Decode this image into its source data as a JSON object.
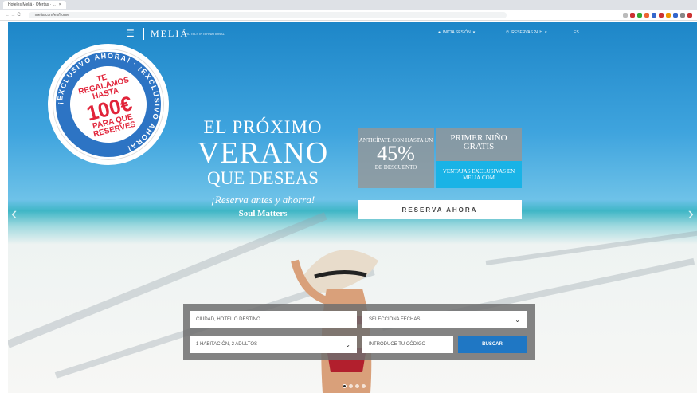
{
  "browser": {
    "tab_title": "Hoteles Meliá · Ofertas · ...",
    "url": "melia.com/es/home",
    "nav_glyphs": "← → C"
  },
  "header": {
    "logo": "MELIÃ",
    "logo_sub": "HOTELS INTERNATIONAL",
    "login": "INICIA SESIÓN",
    "phone": "RESERVAS 24 H",
    "lang": "ES"
  },
  "badge": {
    "ring_text": "¡EXCLUSIVO AHORA! · ¡EXCLUSIVO AHORA!",
    "line1": "TE",
    "line2": "REGALAMOS",
    "line3": "HASTA",
    "amount": "100€",
    "line4": "PARA QUE",
    "line5": "RESERVES"
  },
  "hero": {
    "line1": "EL PRÓXIMO",
    "line2": "VERANO",
    "line3": "QUE DESEAS",
    "tagline": "¡Reserva antes y ahorra!",
    "brand": "Soul Matters"
  },
  "promo": {
    "left_top": "ANTICÍPATE CON HASTA UN",
    "percent": "45%",
    "left_bottom": "DE DESCUENTO",
    "right_top": "PRIMER NIÑO GRATIS",
    "right_bottom": "VENTAJAS EXCLUSIVAS EN MELIA.COM",
    "cta": "RESERVA AHORA"
  },
  "search": {
    "destination_placeholder": "CIUDAD, HOTEL O DESTINO",
    "dates_placeholder": "SELECCIONA FECHAS",
    "rooms_value": "1 HABITACIÓN, 2 ADULTOS",
    "code_placeholder": "INTRODUCE TU CÓDIGO",
    "search_button": "BUSCAR"
  },
  "colors": {
    "accent": "#1f77c4",
    "promo_blue": "#19b3e6",
    "badge_red": "#e1243a"
  }
}
